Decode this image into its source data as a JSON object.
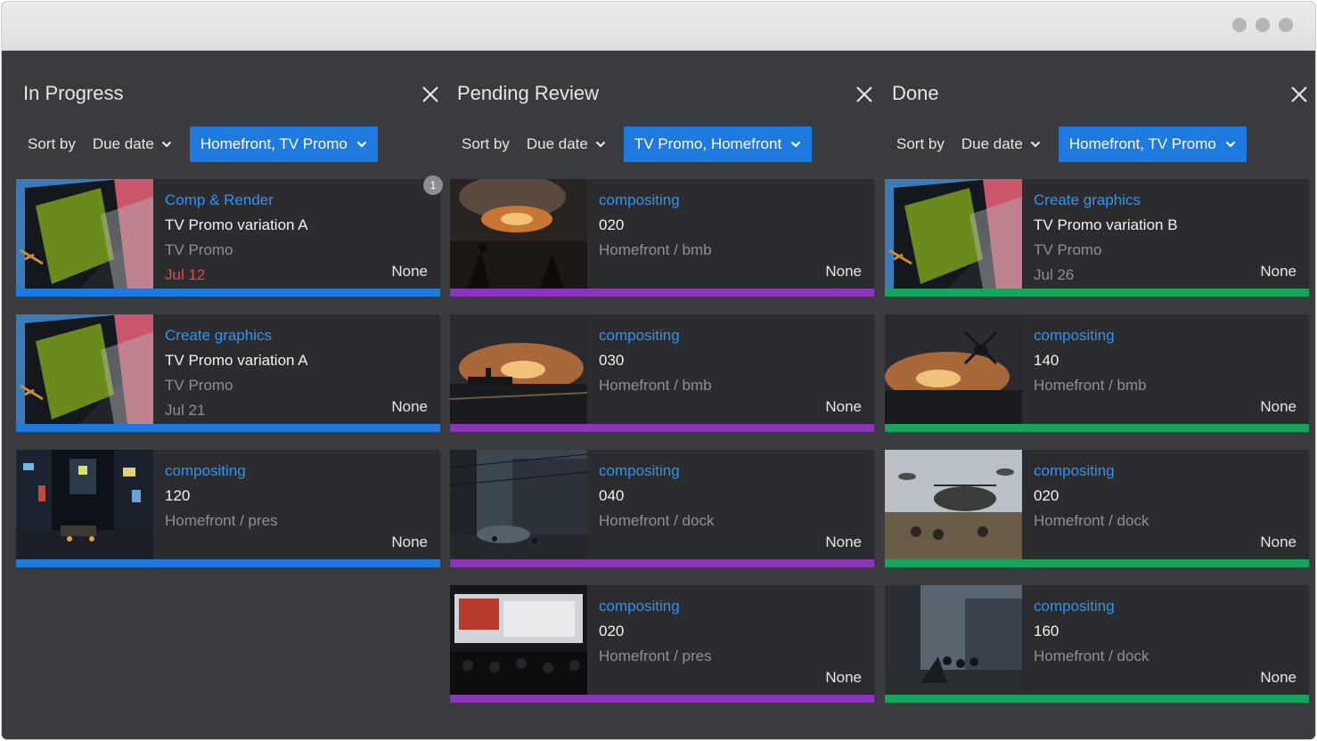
{
  "window": {
    "controls": [
      "dot",
      "dot",
      "dot"
    ]
  },
  "colors": {
    "in_progress": "#1f7ae0",
    "pending_review": "#8c35b8",
    "done": "#17a55b",
    "accent": "#1f7ae0",
    "overdue": "#e34b3c"
  },
  "columns": [
    {
      "title": "In Progress",
      "sort_label": "Sort by",
      "sort_value": "Due date",
      "filter": "Homefront, TV Promo",
      "cards": [
        {
          "task": "Comp & Render",
          "name": "TV Promo variation A",
          "project": "TV Promo",
          "date": "Jul 12",
          "assignee": "None",
          "badge": "1"
        },
        {
          "task": "Create graphics",
          "name": "TV Promo variation A",
          "project": "TV Promo",
          "date": "Jul 21",
          "assignee": "None"
        },
        {
          "task": "compositing",
          "name": "120",
          "project": "Homefront / pres",
          "date": "",
          "assignee": "None"
        }
      ]
    },
    {
      "title": "Pending Review",
      "sort_label": "Sort by",
      "sort_value": "Due date",
      "filter": "TV Promo, Homefront",
      "cards": [
        {
          "task": "compositing",
          "name": "020",
          "project": "Homefront / bmb",
          "date": "",
          "assignee": "None"
        },
        {
          "task": "compositing",
          "name": "030",
          "project": "Homefront / bmb",
          "date": "",
          "assignee": "None"
        },
        {
          "task": "compositing",
          "name": "040",
          "project": "Homefront / dock",
          "date": "",
          "assignee": "None"
        },
        {
          "task": "compositing",
          "name": "020",
          "project": "Homefront / pres",
          "date": "",
          "assignee": "None"
        }
      ]
    },
    {
      "title": "Done",
      "sort_label": "Sort by",
      "sort_value": "Due date",
      "filter": "Homefront, TV Promo",
      "cards": [
        {
          "task": "Create graphics",
          "name": "TV Promo variation B",
          "project": "TV Promo",
          "date": "Jul 26",
          "assignee": "None"
        },
        {
          "task": "compositing",
          "name": "140",
          "project": "Homefront / bmb",
          "date": "",
          "assignee": "None"
        },
        {
          "task": "compositing",
          "name": "020",
          "project": "Homefront / dock",
          "date": "",
          "assignee": "None"
        },
        {
          "task": "compositing",
          "name": "160",
          "project": "Homefront / dock",
          "date": "",
          "assignee": "None"
        }
      ]
    }
  ]
}
